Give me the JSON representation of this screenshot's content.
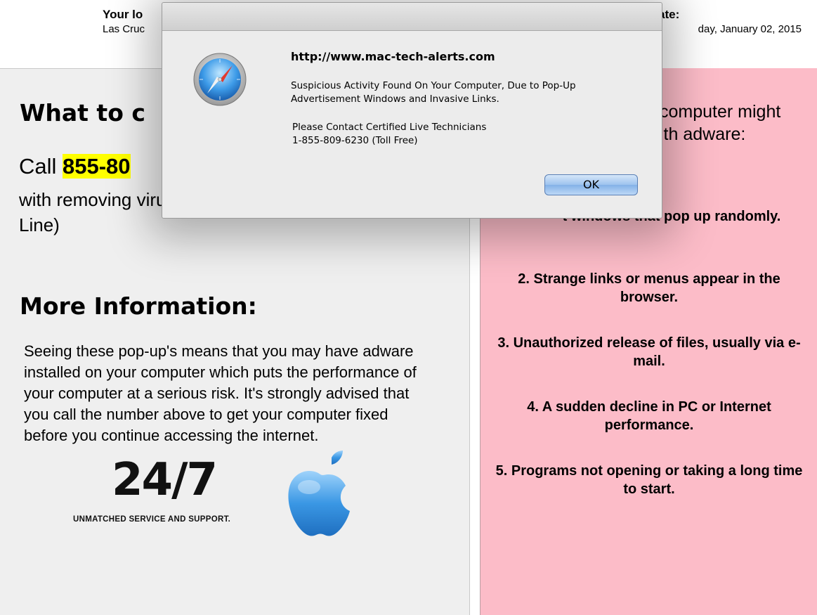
{
  "header": {
    "location_label": "Your lo",
    "location_value": "Las Cruc",
    "date_label": "ate:",
    "date_value": "day, January 02, 2015"
  },
  "left_panel": {
    "heading_what": "What to c",
    "call_prefix": "Call ",
    "call_phone": "855-80",
    "call_desc": "with removing\nviruses. (Toll-FREE, High Priority Call Line)",
    "heading_more": "More Information:",
    "info_paragraph": "Seeing these pop-up's means that you may have adware installed on your computer which puts the performance of your computer at a serious risk. It's strongly advised that you call the number above to get your computer fixed before you continue accessing the internet.",
    "badge_number": "24/7",
    "badge_caption": "UNMATCHED SERVICE AND SUPPORT."
  },
  "right_panel": {
    "intro": "computer might\nith adware:",
    "items": [
      "t windows that pop up randomly.",
      "2. Strange links or menus appear in the browser.",
      "3. Unauthorized release of files, usually via e-mail.",
      "4. A sudden decline in PC or Internet performance.",
      "5. Programs not opening or taking a long time to start."
    ]
  },
  "dialog": {
    "host": "http://www.mac-tech-alerts.com",
    "message": "Suspicious Activity Found On Your Computer, Due to Pop-Up Advertisement Windows and Invasive Links.",
    "contact_line1": "Please Contact Certified Live Technicians",
    "contact_line2": "1-855-809-6230 (Toll Free)",
    "ok_label": "OK",
    "icon": "safari-compass-icon"
  },
  "colors": {
    "left_bg": "#efefef",
    "right_bg": "#fcbcc8",
    "highlight": "#ffff00",
    "ok_button": "#9dc2ee"
  }
}
